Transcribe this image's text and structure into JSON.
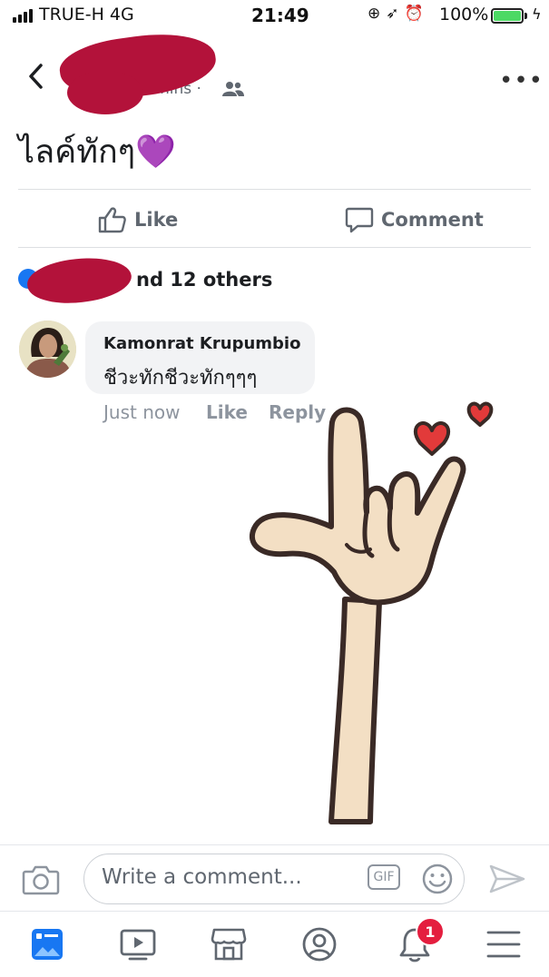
{
  "status_bar": {
    "carrier": "TRUE-H  4G",
    "time": "21:49",
    "battery_percent": "100%",
    "battery_level": 1.0,
    "icons": [
      "lock-rotation-icon",
      "location-icon",
      "alarm-icon",
      "charging-icon"
    ]
  },
  "header": {
    "timestamp": "4 mins ·",
    "privacy_icon": "friends-icon"
  },
  "post": {
    "text": "ไลค์ทักๆ💜"
  },
  "actions": {
    "like_label": "Like",
    "comment_label": "Comment"
  },
  "reactions": {
    "summary": "nd 12 others"
  },
  "comment": {
    "author": "Kamonrat Krupumbio",
    "text": "ชีวะทักชีวะทักๆๆๆ",
    "time": "Just now",
    "like_label": "Like",
    "reply_label": "Reply"
  },
  "composer": {
    "placeholder": "Write a comment...",
    "gif_label": "GIF"
  },
  "bottom_nav": {
    "items": [
      "news-feed-icon",
      "watch-icon",
      "marketplace-icon",
      "profile-icon",
      "notifications-icon",
      "menu-icon"
    ],
    "notification_count": "1"
  },
  "colors": {
    "accent": "#1877f2",
    "redaction": "#b3123a",
    "badge": "#e41e3f",
    "muted": "#606770"
  }
}
